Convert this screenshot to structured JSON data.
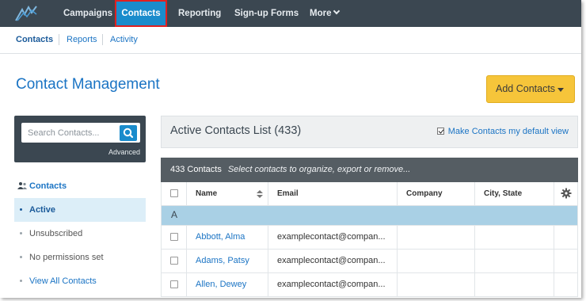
{
  "topnav": {
    "items": [
      "Campaigns",
      "Contacts",
      "Reporting",
      "Sign-up Forms",
      "More"
    ],
    "active": "Contacts"
  },
  "subnav": {
    "items": [
      "Contacts",
      "Reports",
      "Activity"
    ]
  },
  "page": {
    "title": "Contact Management",
    "add_button": "Add Contacts"
  },
  "search": {
    "placeholder": "Search Contacts...",
    "advanced": "Advanced"
  },
  "sidebar": {
    "header": "Contacts",
    "items": [
      {
        "label": "Active",
        "state": "active"
      },
      {
        "label": "Unsubscribed"
      },
      {
        "label": "No permissions set"
      },
      {
        "label": "View All Contacts"
      }
    ]
  },
  "list": {
    "title": "Active Contacts List (433)",
    "default_view_label": "Make Contacts my default view",
    "count_label": "433 Contacts",
    "hint": "Select contacts to organize, export or remove..."
  },
  "table": {
    "columns": [
      "Name",
      "Email",
      "Company",
      "City, State"
    ],
    "group_letter": "A",
    "rows": [
      {
        "name": "Abbott, Alma",
        "email": "examplecontact@compan...",
        "company": "",
        "city": ""
      },
      {
        "name": "Adams, Patsy",
        "email": "examplecontact@compan...",
        "company": "",
        "city": ""
      },
      {
        "name": "Allen, Dewey",
        "email": "examplecontact@compan...",
        "company": "",
        "city": ""
      }
    ]
  },
  "colors": {
    "nav_bg": "#3b4751",
    "accent": "#1a8ccc",
    "button": "#f6c53a",
    "link": "#1b74c4"
  }
}
